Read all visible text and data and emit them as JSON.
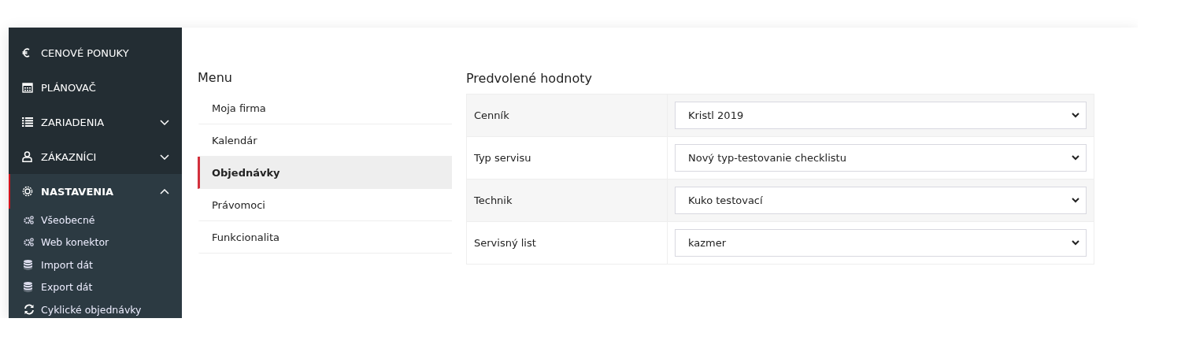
{
  "sidebar": {
    "items": [
      {
        "label": "CENOVÉ PONUKY",
        "selected": false
      },
      {
        "label": "PLÁNOVAČ",
        "selected": false
      },
      {
        "label": "ZARIADENIA",
        "selected": false,
        "expanded": false
      },
      {
        "label": "ZÁKAZNÍCI",
        "selected": false,
        "expanded": false
      },
      {
        "label": "NASTAVENIA",
        "selected": true,
        "expanded": true,
        "children": [
          {
            "label": "Všeobecné"
          },
          {
            "label": "Web konektor"
          },
          {
            "label": "Import dát"
          },
          {
            "label": "Export dát"
          },
          {
            "label": "Cyklické objednávky"
          }
        ]
      }
    ]
  },
  "menu": {
    "title": "Menu",
    "items": [
      {
        "label": "Moja firma",
        "selected": false
      },
      {
        "label": "Kalendár",
        "selected": false
      },
      {
        "label": "Objednávky",
        "selected": true
      },
      {
        "label": "Právomoci",
        "selected": false
      },
      {
        "label": "Funkcionalita",
        "selected": false
      }
    ]
  },
  "defaults": {
    "title": "Predvolené hodnoty",
    "rows": [
      {
        "label": "Cenník",
        "value": "Kristl 2019"
      },
      {
        "label": "Typ servisu",
        "value": "Nový typ-testovanie checklistu"
      },
      {
        "label": "Technik",
        "value": "Kuko testovací"
      },
      {
        "label": "Servisný list",
        "value": "kazmer"
      }
    ]
  }
}
